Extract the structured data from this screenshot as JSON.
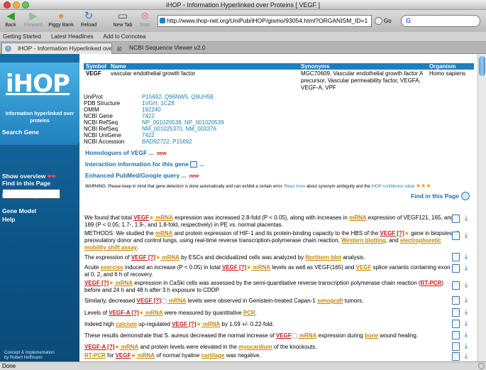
{
  "window": {
    "title": "iHOP - Information Hyperlinked over Proteins [ VEGF ]"
  },
  "toolbar": {
    "back": "Back",
    "forward": "Forward",
    "piggy": "Piggy Bank",
    "reload": "Reload",
    "newtab": "New Tab",
    "stop": "Stop",
    "url": "http://www.ihop-net.org/UniPub/iHOP/gismo/93054.html?ORGANISM_ID=1",
    "go": "Go",
    "google_value": "G"
  },
  "bookmarks": {
    "items": [
      "Getting Started",
      "Latest Headlines",
      "Add to Connotea"
    ]
  },
  "tabs": [
    {
      "label": "iHOP - Information Hyperlinked over Proteins [ VEGF ]",
      "active": true
    },
    {
      "label": "NCBI Sequence Viewer v2.0",
      "active": false
    }
  ],
  "sidebar": {
    "logo": "iHOP",
    "logo_subtitle": "Information hyperlinked over proteins",
    "search_label": "Search Gene",
    "show_overview": "Show overview",
    "find_in_page": "Find in this Page",
    "filter": "Filter and options",
    "gene_model": "Gene Model",
    "help": "Help",
    "footer1": "Concept & Implementation",
    "footer2": "by Robert Hoffmann"
  },
  "gene": {
    "headers": {
      "symbol": "Symbol",
      "name": "Name",
      "synonyms": "Synonyms",
      "organism": "Organism"
    },
    "symbol": "VEGF",
    "name": "vascular endothelial growth factor",
    "synonyms": "MGC70609, Vascular endothelial growth factor A precursor, Vascular permeability factor, VEGFA, VEGF-A, VPF",
    "organism": "Homo sapiens",
    "ids": [
      {
        "key": "UniProt",
        "value": "P15692, Q96NW5, Q9UH58"
      },
      {
        "key": "PDB Structure",
        "value": "1VGH, 1CZ8"
      },
      {
        "key": "OMIM",
        "value": "192240"
      },
      {
        "key": "NCBI Gene",
        "value": "7422"
      },
      {
        "key": "NCBI RefSeq",
        "value": "NP_001020538, NP_001020539"
      },
      {
        "key": "NCBI RefSeq",
        "value": "NM_001025370, NM_003376"
      },
      {
        "key": "NCBI UniGene",
        "value": "7422"
      },
      {
        "key": "NCBI Accession",
        "value": "BAD92722, P15692"
      }
    ]
  },
  "links": {
    "homologues": "Homologues of VEGF ...",
    "interaction": "Interaction information for this gene",
    "interaction_tail": "...",
    "enhanced": "Enhanced PubMed/Google query ...",
    "new": "new"
  },
  "warning": {
    "part1": "WARNING: Please keep in mind that gene detection is done automatically and can exhibit a certain error.",
    "read_more": "Read more",
    "part2": "about synonym ambiguity and the",
    "confidence": "iHOP confidence value"
  },
  "find_in_page": "Find in this Page",
  "sentences": {
    "s1": {
      "a": "We found that total ",
      "b": "VEGF",
      "c": " mRNA",
      "d": " expression was increased 2.8-fold (P < 0.05), along with increases in ",
      "e": "mRNA",
      "f": " expression of VEGF121, 165, and 189 (P < 0.05; 1.7-, 1.9-, and 1.8-fold, respectively) in PE vs. normal placentas."
    },
    "s2": {
      "a": "METHODS: We studied the ",
      "b": "mRNA",
      "c": " and protein expression of HIF-1 and its protein-binding capacity to the HBS of the ",
      "d": "VEGF [?]",
      "e": " gene in biopsies of preovulatory donor and control lungs, using real-time reverse transcription-polymerase chain reaction, ",
      "f": "Western blotting",
      "g": ", and ",
      "h": "electrophoretic mobility shift assay",
      "i": "."
    },
    "s3": {
      "a": "The expression of ",
      "b": "VEGF [?]",
      "c": " mRNA",
      "d": " by ESCs and decidualized cells was analyzed by ",
      "e": "Northern blot",
      "f": " analysis."
    },
    "s4": {
      "a": "Acute ",
      "b": "exercise",
      "c": " induced an increase (P < 0.05) in total ",
      "d": "VEGF [?]",
      "e": " mRNA",
      "f": " levels as well as VEGF(165) and ",
      "g": "VEGF",
      "h": " splice variants containing exon 7 at 0, 2, and 6 h of recovery."
    },
    "s5": {
      "a": "VEGF [?]",
      "b": " mRNA",
      "c": " expression in CaSki cells was assessed by the semi-quantitative reverse transcription polymerase chain reaction (",
      "d": "RT-PCR",
      "e": ") before and 24 h and 48 h after 3 h exposure to CDDP."
    },
    "s6": {
      "a": "Similarly, decreased ",
      "b": "VEGF [?]",
      "c": " mRNA",
      "d": " levels were observed in Genistein-treated Capan-1 ",
      "e": "xenograft",
      "f": " tumors."
    },
    "s7": {
      "a": "Levels of ",
      "b": "VEGF-A [?]",
      "c": " mRNA",
      "d": " were measured by quantitative ",
      "e": "PCR",
      "f": "."
    },
    "s8": {
      "a": "Indeed high ",
      "b": "calcium",
      "c": " up-regulated ",
      "d": "VEGF [?]",
      "e": " mRNA",
      "f": " by 1.59 +/- 0.22-fold."
    },
    "s9": {
      "a": "These results demonstrate that S. aureus decreased the normal increase of ",
      "b": "VEGF",
      "c": " mRNA",
      "d": " expression during ",
      "e": "bone",
      "f": " wound healing."
    },
    "s10": {
      "a": "VEGF-A [?]",
      "b": " mRNA",
      "c": " and protein levels were elevated in the ",
      "d": "myocardium",
      "e": " of the knockouts."
    },
    "s11": {
      "a": "RT-PCR",
      "b": " for ",
      "c": "VEGF",
      "d": " mRNA",
      "e": " of normal hyaline ",
      "f": "cartilage",
      "g": " was negative."
    }
  },
  "status": "Done",
  "colors": {
    "accent": "#1c7fc0",
    "gene": "#c91515",
    "term": "#c68600",
    "sidebar": "#0c5589"
  }
}
